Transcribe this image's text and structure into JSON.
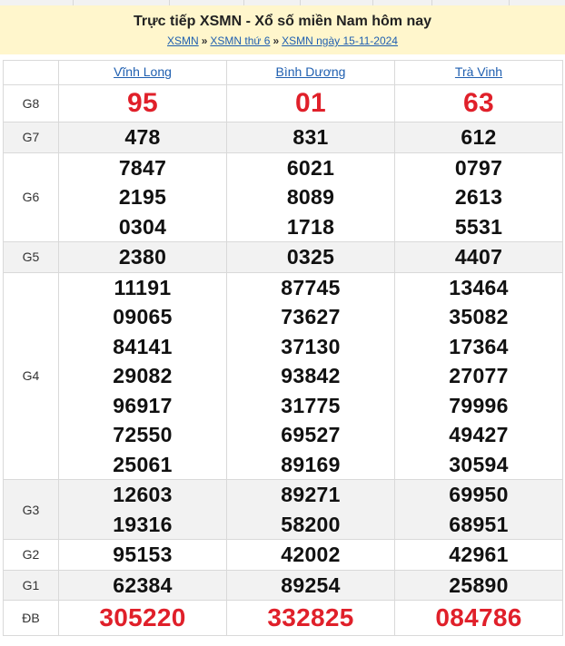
{
  "header": {
    "title": "Trực tiếp XSMN - Xổ số miền Nam hôm nay",
    "breadcrumb": [
      {
        "label": "XSMN"
      },
      {
        "label": "XSMN thứ 6"
      },
      {
        "label": "XSMN ngày 15-11-2024"
      }
    ],
    "separator": "»"
  },
  "columns": [
    "Vĩnh Long",
    "Bình Dương",
    "Trà Vinh"
  ],
  "prizes": {
    "g8": {
      "label": "G8",
      "values": [
        [
          "95"
        ],
        [
          "01"
        ],
        [
          "63"
        ]
      ]
    },
    "g7": {
      "label": "G7",
      "values": [
        [
          "478"
        ],
        [
          "831"
        ],
        [
          "612"
        ]
      ]
    },
    "g6": {
      "label": "G6",
      "values": [
        [
          "7847",
          "2195",
          "0304"
        ],
        [
          "6021",
          "8089",
          "1718"
        ],
        [
          "0797",
          "2613",
          "5531"
        ]
      ]
    },
    "g5": {
      "label": "G5",
      "values": [
        [
          "2380"
        ],
        [
          "0325"
        ],
        [
          "4407"
        ]
      ]
    },
    "g4": {
      "label": "G4",
      "values": [
        [
          "11191",
          "09065",
          "84141",
          "29082",
          "96917",
          "72550",
          "25061"
        ],
        [
          "87745",
          "73627",
          "37130",
          "93842",
          "31775",
          "69527",
          "89169"
        ],
        [
          "13464",
          "35082",
          "17364",
          "27077",
          "79996",
          "49427",
          "30594"
        ]
      ]
    },
    "g3": {
      "label": "G3",
      "values": [
        [
          "12603",
          "19316"
        ],
        [
          "89271",
          "58200"
        ],
        [
          "69950",
          "68951"
        ]
      ]
    },
    "g2": {
      "label": "G2",
      "values": [
        [
          "95153"
        ],
        [
          "42002"
        ],
        [
          "42961"
        ]
      ]
    },
    "g1": {
      "label": "G1",
      "values": [
        [
          "62384"
        ],
        [
          "89254"
        ],
        [
          "25890"
        ]
      ]
    },
    "db": {
      "label": "ĐB",
      "values": [
        [
          "305220"
        ],
        [
          "332825"
        ],
        [
          "084786"
        ]
      ]
    }
  },
  "colors": {
    "accent_red": "#e0202a",
    "link_blue": "#1f5fb0",
    "header_bg": "#fff6cc"
  }
}
